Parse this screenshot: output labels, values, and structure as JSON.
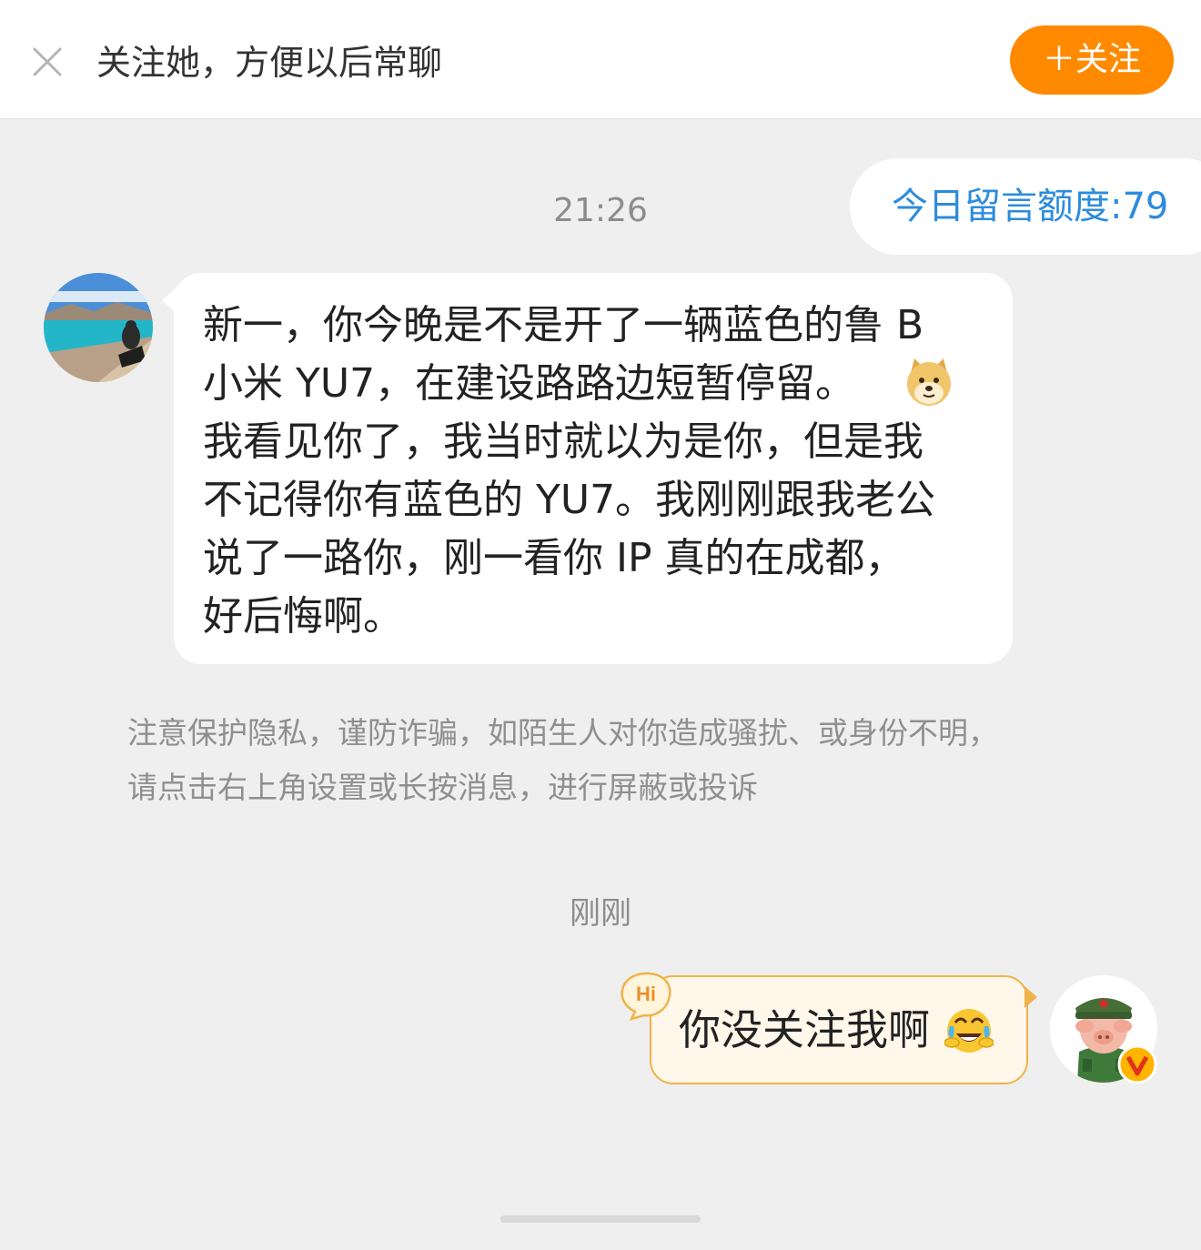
{
  "banner": {
    "prompt_text": "关注她，方便以后常聊",
    "follow_label": "＋关注",
    "close_icon": "close-icon"
  },
  "quota": {
    "text": "今日留言额度:79"
  },
  "conversation": {
    "time_first": "21:26",
    "incoming_message": {
      "lines": [
        "新一，你今晚是不是开了一辆蓝色的鲁 B",
        "小米 YU7，在建设路路边短暂停留。",
        "我看见你了，我当时就以为是你，但是我",
        "不记得你有蓝色的 YU7。我刚刚跟我老公",
        "说了一路你，刚一看你 IP 真的在成都，",
        "好后悔啊。"
      ],
      "emoji": "doge-emoji"
    },
    "notice_lines": [
      "注意保护隐私，谨防诈骗，如陌生人对你造成骚扰、或身份不明，",
      "请点击右上角设置或长按消息，进行屏蔽或投诉"
    ],
    "time_second": "刚刚",
    "outgoing_message": {
      "text": "你没关注我啊",
      "emoji": "laugh-cry-emoji",
      "badge_text": "Hi"
    }
  },
  "colors": {
    "accent_orange": "#ff8a00",
    "quota_blue": "#2d8cdc",
    "background": "#efefef",
    "outgoing_border": "#f0b24a"
  }
}
